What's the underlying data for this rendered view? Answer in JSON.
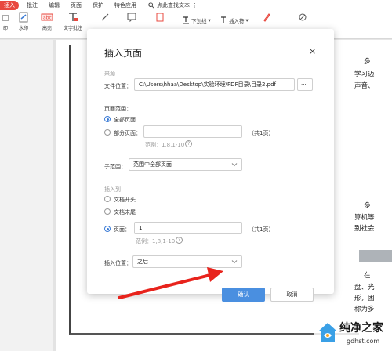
{
  "menubar": {
    "items": [
      "插入",
      "批注",
      "编辑",
      "页面",
      "保护",
      "特色应用"
    ],
    "active_index": 0,
    "search_label": "点此查找文本",
    "more": "⋮"
  },
  "toolbar": {
    "watermark_left": "印",
    "watermark": "水印",
    "highlight": "高亮",
    "text_comment": "文字批注",
    "underline": "下划线",
    "insert_mark": "插入符"
  },
  "doc_right": [
    "多",
    "学习迈",
    "声音、",
    "多",
    "算机等",
    "别社会",
    "在",
    "盘、光",
    "形，困",
    "称为多"
  ],
  "dialog": {
    "title": "插入页面",
    "close": "×",
    "source_section": "来源",
    "file_label": "文件位置：",
    "file_path": "C:\\Users\\hhaa\\Desktop\\实验环境\\PDF目录\\目录2.pdf",
    "browse": "···",
    "range_section": "页面范围：",
    "all_pages": "全部页面",
    "part_pages": "部分页面：",
    "total1": "（共1页）",
    "example1": "范例：1,8,1-10",
    "help": "?",
    "sub_label": "子范围：",
    "sub_value": "范围中全部页面",
    "insert_to": "插入到",
    "doc_start": "文档开头",
    "doc_end": "文档末尾",
    "page_label": "页面：",
    "page_value": "1",
    "total2": "（共1页）",
    "example2": "范例：1,8,1-10",
    "position_label": "插入位置：",
    "position_value": "之后",
    "ok": "确认",
    "cancel": "取消"
  },
  "watermark": {
    "brand": "纯净之家",
    "url": "gdhst.com"
  }
}
